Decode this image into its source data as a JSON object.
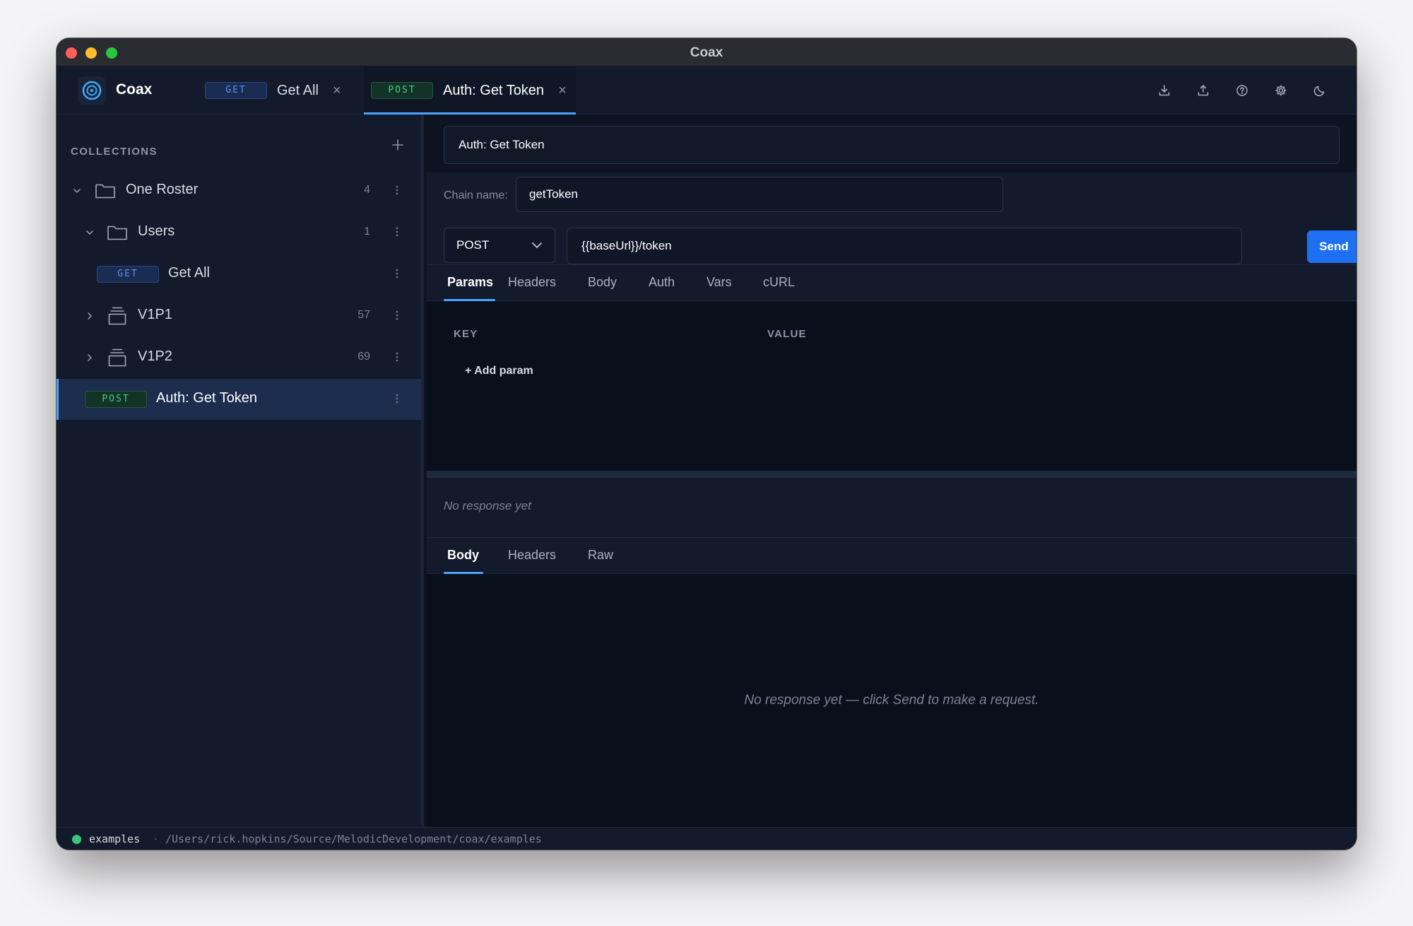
{
  "window": {
    "title": "Coax"
  },
  "app": {
    "name": "Coax"
  },
  "tabs": [
    {
      "method": "GET",
      "label": "Get All",
      "close": "×"
    },
    {
      "method": "POST",
      "label": "Auth: Get Token",
      "close": "×"
    }
  ],
  "toolbar": {
    "icons": [
      "import-icon",
      "export-icon",
      "help-icon",
      "settings-gear-icon",
      "dark-mode-moon-icon"
    ]
  },
  "sidebar": {
    "header": "COLLECTIONS",
    "add": "+",
    "tree": [
      {
        "label": "One Roster",
        "count": "4",
        "type": "folder",
        "expanded": true
      },
      {
        "label": "Users",
        "count": "1",
        "type": "folder",
        "expanded": true
      },
      {
        "label": "Get All",
        "method": "GET",
        "type": "request"
      },
      {
        "label": "V1P1",
        "count": "57",
        "type": "collection",
        "expanded": false
      },
      {
        "label": "V1P2",
        "count": "69",
        "type": "collection",
        "expanded": false
      },
      {
        "label": "Auth: Get Token",
        "method": "POST",
        "type": "request",
        "selected": true
      }
    ]
  },
  "request": {
    "name": "Auth: Get Token",
    "chain_label": "Chain name:",
    "chain_value": "getToken",
    "method": "POST",
    "url": "{{baseUrl}}/token",
    "send_label": "Send",
    "tabs": [
      "Params",
      "Headers",
      "Body",
      "Auth",
      "Vars",
      "cURL"
    ],
    "active_tab": "Params",
    "params": {
      "key_header": "KEY",
      "value_header": "VALUE",
      "add_label": "+ Add param"
    }
  },
  "response": {
    "status": "No response yet",
    "tabs": [
      "Body",
      "Headers",
      "Raw"
    ],
    "active_tab": "Body",
    "empty_message": "No response yet — click Send to make a request."
  },
  "statusbar": {
    "workspace": "examples",
    "separator": "·",
    "path": "/Users/rick.hopkins/Source/MelodicDevelopment/coax/examples"
  },
  "colors": {
    "accent": "#4ea1ff",
    "send_button": "#1e6ff2",
    "get_badge": "#5b8ff0",
    "post_badge": "#3fcf85",
    "status_dot": "#3cc47c"
  }
}
